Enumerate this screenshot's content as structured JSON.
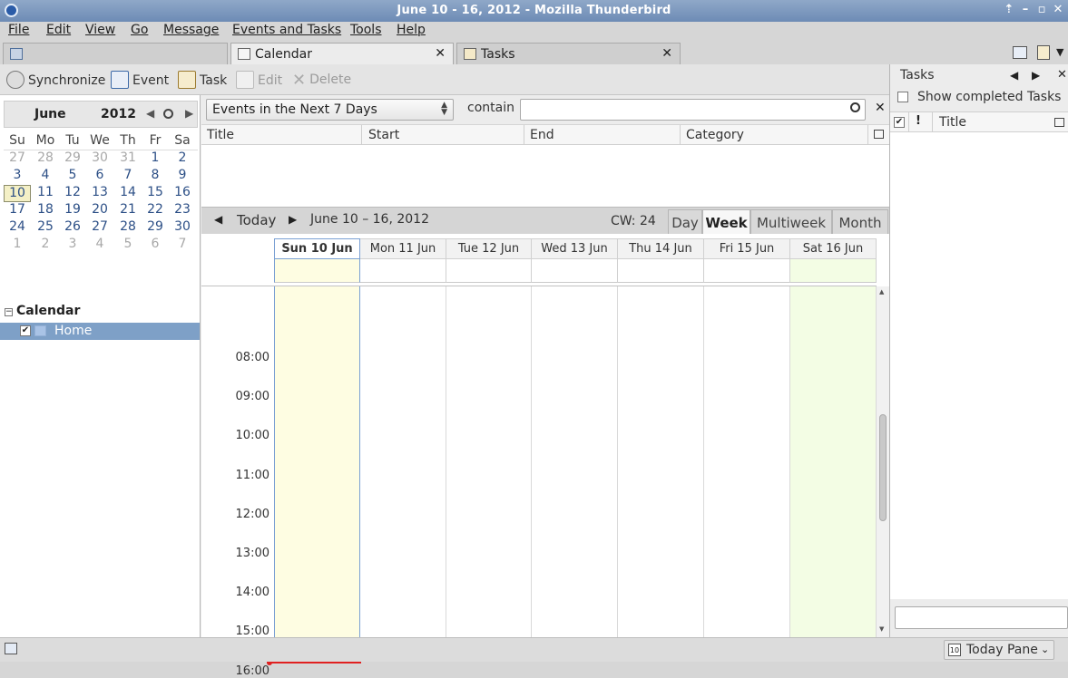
{
  "window": {
    "title": "June 10 - 16, 2012 - Mozilla Thunderbird"
  },
  "menu": [
    "File",
    "Edit",
    "View",
    "Go",
    "Message",
    "Events and Tasks",
    "Tools",
    "Help"
  ],
  "tabs": [
    {
      "label": ""
    },
    {
      "label": "Calendar"
    },
    {
      "label": "Tasks"
    }
  ],
  "toolbar": {
    "sync": "Synchronize",
    "event": "Event",
    "task": "Task",
    "edit": "Edit",
    "delete": "Delete"
  },
  "minimonth": {
    "month": "June",
    "year": "2012",
    "daynames": [
      "Su",
      "Mo",
      "Tu",
      "We",
      "Th",
      "Fr",
      "Sa"
    ],
    "weeks": [
      [
        "27",
        "28",
        "29",
        "30",
        "31",
        "1",
        "2"
      ],
      [
        "3",
        "4",
        "5",
        "6",
        "7",
        "8",
        "9"
      ],
      [
        "10",
        "11",
        "12",
        "13",
        "14",
        "15",
        "16"
      ],
      [
        "17",
        "18",
        "19",
        "20",
        "21",
        "22",
        "23"
      ],
      [
        "24",
        "25",
        "26",
        "27",
        "28",
        "29",
        "30"
      ],
      [
        "1",
        "2",
        "3",
        "4",
        "5",
        "6",
        "7"
      ]
    ]
  },
  "calendars": {
    "section": "Calendar",
    "items": [
      {
        "name": "Home",
        "checked": true
      }
    ]
  },
  "filter": {
    "range": "Events in the Next 7 Days",
    "contain": "contain",
    "search_value": ""
  },
  "event_list": {
    "columns": [
      "Title",
      "Start",
      "End",
      "Category"
    ]
  },
  "weeknav": {
    "today": "Today",
    "range": "June 10 – 16, 2012",
    "cw": "CW: 24",
    "views": [
      "Day",
      "Week",
      "Multiweek",
      "Month"
    ],
    "active_view": "Week"
  },
  "week": {
    "days": [
      "Sun 10 Jun",
      "Mon 11 Jun",
      "Tue 12 Jun",
      "Wed 13 Jun",
      "Thu 14 Jun",
      "Fri 15 Jun",
      "Sat 16 Jun"
    ],
    "hours": [
      "08:00",
      "09:00",
      "10:00",
      "11:00",
      "12:00",
      "13:00",
      "14:00",
      "15:00",
      "16:00"
    ]
  },
  "tasks_pane": {
    "title": "Tasks",
    "show_completed": "Show completed Tasks",
    "column_title": "Title",
    "quick_add_value": ""
  },
  "statusbar": {
    "today_pane": "Today Pane",
    "today_icon_day": "10"
  },
  "colors": {
    "today_column": "#fefde2",
    "weekend_column": "#f3fde4",
    "selection": "#7ea0c7",
    "now_line": "#e02020"
  }
}
